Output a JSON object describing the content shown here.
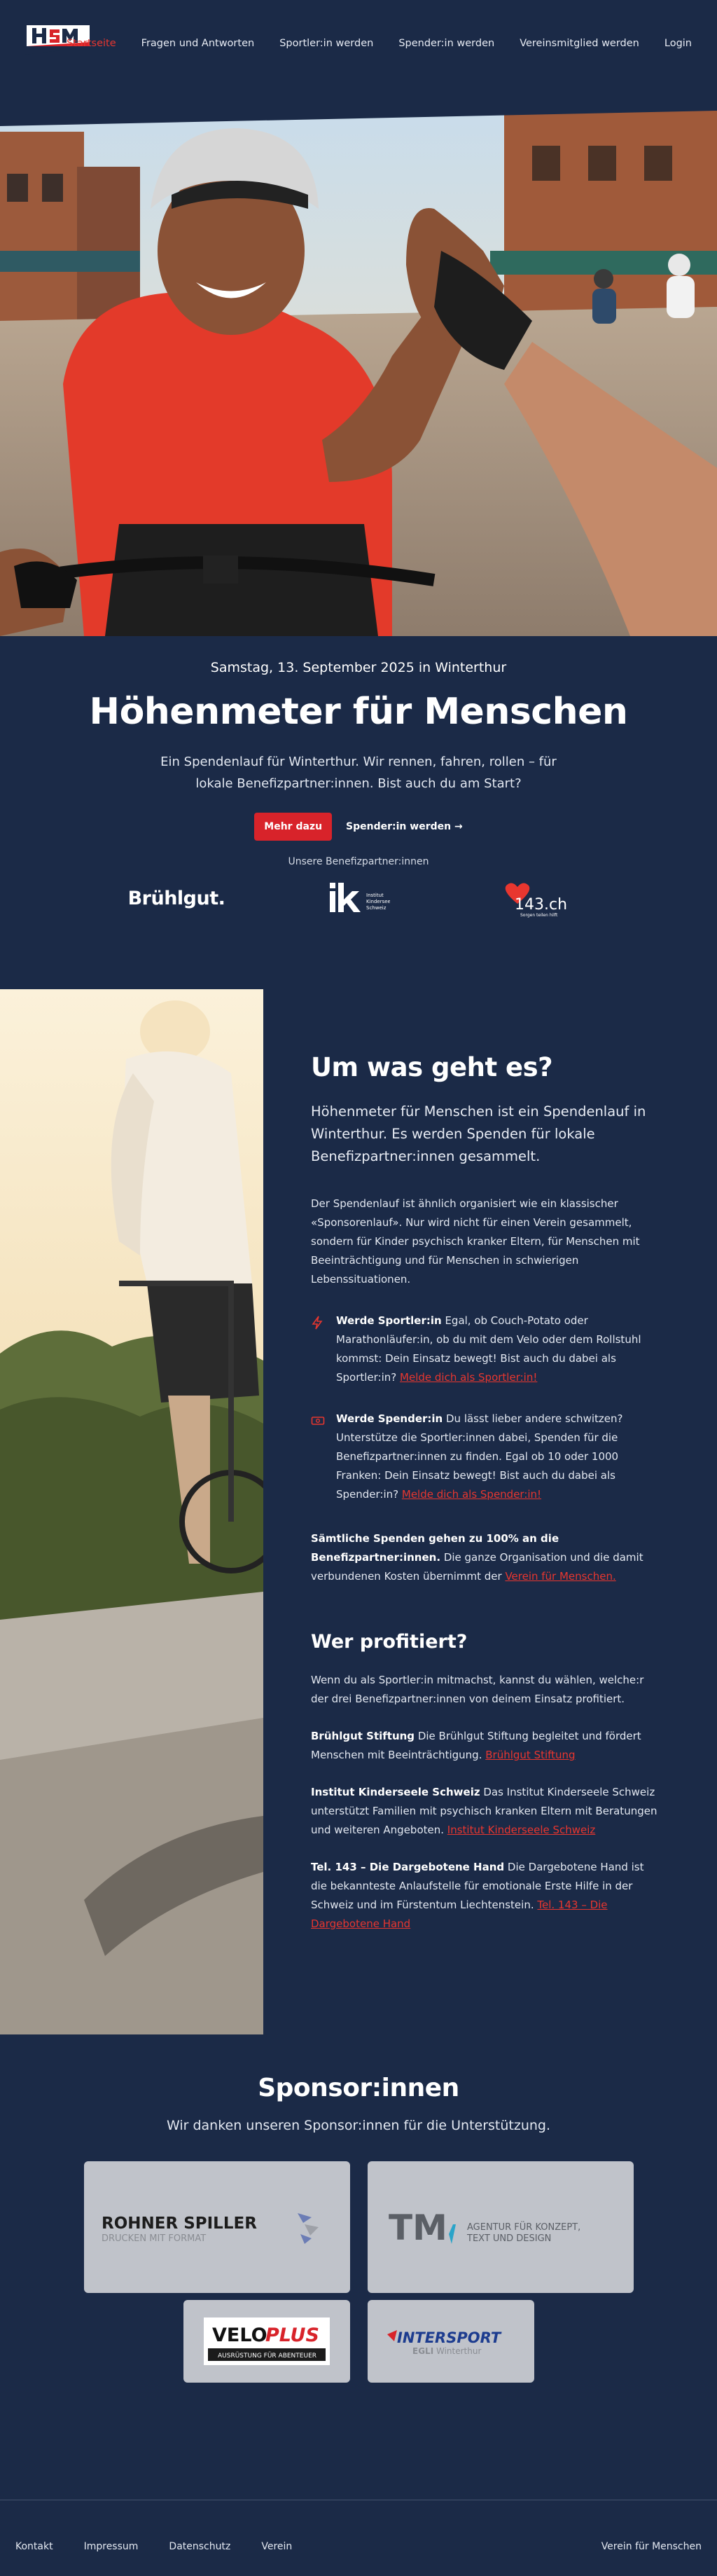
{
  "header": {
    "nav": [
      {
        "label": "Startseite",
        "active": true
      },
      {
        "label": "Fragen und Antworten",
        "active": false
      },
      {
        "label": "Sportler:in werden",
        "active": false
      },
      {
        "label": "Spender:in werden",
        "active": false
      },
      {
        "label": "Vereinsmitglied werden",
        "active": false
      },
      {
        "label": "Login",
        "active": false
      }
    ]
  },
  "hero": {
    "date": "Samstag, 13. September 2025 in Winterthur",
    "title": "Höhenmeter für Menschen",
    "lead": "Ein Spendenlauf für Winterthur. Wir rennen, fahren, rollen – für lokale Benefizpartner:innen. Bist auch du am Start?",
    "cta_primary": "Mehr dazu",
    "cta_secondary": "Spender:in werden →",
    "partners_label": "Unsere Benefizpartner:innen",
    "partner_bruehl": "Brühlgut.",
    "partner_ik_line1": "Institut",
    "partner_ik_line2": "Kinderseele",
    "partner_ik_line3": "Schweiz",
    "partner_143": "143.ch",
    "partner_143_tag": "Sorgen teilen hilft"
  },
  "about": {
    "title": "Um was geht es?",
    "subtitle": "Höhenmeter für Menschen ist ein Spendenlauf in Winterthur. Es werden Spenden für lokale Benefizpartner:innen gesammelt.",
    "text": "Der Spendenlauf ist ähnlich organisiert wie ein klassischer «Sponsorenlauf». Nur wird nicht für einen Verein gesammelt, sondern für Kinder psychisch kranker Eltern, für Menschen mit Beeinträchtigung und für Menschen in schwierigen Lebenssituationen.",
    "f1_bold": "Werde Sportler:in",
    "f1_text": " Egal, ob Couch-Potato oder Marathonläufer:in, ob du mit dem Velo oder dem Rollstuhl kommst: Dein Einsatz bewegt! Bist auch du dabei als Sportler:in? ",
    "f1_link": "Melde dich als Sportler:in!",
    "f2_bold": "Werde Spender:in",
    "f2_text": " Du lässt lieber andere schwitzen? Unterstütze die Sportler:innen dabei, Spenden für die Benefizpartner:innen zu finden. Egal ob 10 oder 1000 Franken: Dein Einsatz bewegt! Bist auch du dabei als Spender:in? ",
    "f2_link": "Melde dich als Spender:in!",
    "note_bold": "Sämtliche Spenden gehen zu 100% an die Benefizpartner:innen.",
    "note_text": " Die ganze Organisation und die damit verbundenen Kosten übernimmt der ",
    "note_link": "Verein für Menschen.",
    "who_title": "Wer profitiert?",
    "who_text": "Wenn du als Sportler:in mitmachst, kannst du wählen, welche:r der drei Benefizpartner:innen von deinem Einsatz profitiert.",
    "p1_bold": "Brühlgut Stiftung",
    "p1_text": " Die Brühlgut Stiftung begleitet und fördert Menschen mit Beeinträchtigung. ",
    "p1_link": "Brühlgut Stiftung",
    "p2_bold": "Institut Kinderseele Schweiz",
    "p2_text": " Das Institut Kinderseele Schweiz unterstützt Familien mit psychisch kranken Eltern mit Beratungen und weiteren Angeboten. ",
    "p2_link": "Institut Kinderseele Schweiz",
    "p3_bold": "Tel. 143 – Die Dargebotene Hand",
    "p3_text": " Die Dargebotene Hand ist die bekannteste Anlaufstelle für emotionale Erste Hilfe in der Schweiz und im Fürstentum Liechtenstein. ",
    "p3_link": "Tel. 143 – Die Dargebotene Hand"
  },
  "sponsors": {
    "title": "Sponsor:innen",
    "subtitle": "Wir danken unseren Sponsor:innen für die Unterstützung.",
    "rohner_name": "ROHNER SPILLER",
    "rohner_tag": "DRUCKEN MIT FORMAT",
    "tm_name": "TM",
    "tm_tag1": "AGENTUR FÜR KONZEPT,",
    "tm_tag2": "TEXT UND DESIGN",
    "velo_a": "VELO",
    "velo_b": "PLUS",
    "velo_tag": "AUSRÜSTUNG FÜR ABENTEUER",
    "intersport": "INTERSPORT",
    "intersport_sub1": "EGLI",
    "intersport_sub2": " Winterthur"
  },
  "footer": {
    "links": [
      "Kontakt",
      "Impressum",
      "Datenschutz",
      "Verein"
    ],
    "right": "Verein für Menschen"
  }
}
